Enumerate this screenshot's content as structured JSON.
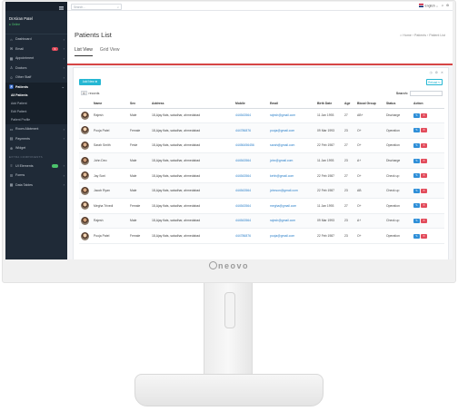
{
  "topbar": {
    "search_placeholder": "Search...",
    "language": "English"
  },
  "sidebar": {
    "user_name": "Dr.Kiran Patel",
    "user_status": "Online",
    "items_top": [
      {
        "label": "Dashboard",
        "icon": "home-icon",
        "name": "dashboard"
      },
      {
        "label": "Email",
        "icon": "envelope-icon",
        "name": "email",
        "badge": "6",
        "badge_color": "#e24b5b"
      },
      {
        "label": "Appointment",
        "icon": "calendar-icon",
        "name": "appointment"
      },
      {
        "label": "Doctors",
        "icon": "user-md-icon",
        "name": "doctors"
      },
      {
        "label": "Other Staff",
        "icon": "users-icon",
        "name": "other-staff"
      }
    ],
    "patients_label": "Patients",
    "patients_sub": [
      "All Patients",
      "Add Patient",
      "Edit Patient",
      "Patient Profile"
    ],
    "items_bottom": [
      {
        "label": "Room Allotment",
        "icon": "bed-icon",
        "name": "room-allotment"
      },
      {
        "label": "Payments",
        "icon": "card-icon",
        "name": "payments"
      }
    ],
    "widget_label": "Widget",
    "section_label": "EXTRA COMPONENTS",
    "items_extra": [
      {
        "label": "UI Elements",
        "icon": "layers-icon",
        "name": "ui-elements",
        "badge": "",
        "badge_color": "#4cc36c"
      },
      {
        "label": "Forms",
        "icon": "form-icon",
        "name": "forms"
      },
      {
        "label": "Data Tables",
        "icon": "table-icon",
        "name": "data-tables"
      }
    ]
  },
  "page": {
    "title": "Patients List",
    "breadcrumb": "⌂ Home  ›  Patients  ›  Patient List",
    "tabs": [
      "List View",
      "Grid View"
    ]
  },
  "card": {
    "tools": "◷ ⚙ ✕",
    "add_label": "Add New ✚",
    "reload_label": "Reload ↻",
    "length_value": "10",
    "length_suffix": "records",
    "search_label": "Search:"
  },
  "table": {
    "headers": [
      "",
      "Name",
      "Sex",
      "Address",
      "Mobile",
      "Email",
      "Birth Date",
      "Age",
      "Blood Group",
      "Status",
      "Action"
    ],
    "rows": [
      {
        "name": "Rajesh",
        "sex": "Male",
        "address": "18,Ajay flats, satadhar, ahmedabad",
        "mobile": "444543564",
        "email": "rajesh@gmail.com",
        "birth": "11 Jan 1993",
        "age": "27",
        "blood": "AB+",
        "status": "Discharge"
      },
      {
        "name": "Pooja Patel",
        "sex": "Female",
        "address": "18,Ajay flats, satadhar, ahmedabad",
        "mobile": "444786876",
        "email": "pooja@gmail.com",
        "birth": "09 Mar 1993",
        "age": "23",
        "blood": "O+",
        "status": "Operation"
      },
      {
        "name": "Sarah Smith",
        "sex": "Fesle",
        "address": "18,Ajay flats, satadhar, ahmedabad",
        "mobile": "44456456456",
        "email": "sarah@gmail.com",
        "birth": "22 Feb 1987",
        "age": "27",
        "blood": "O+",
        "status": "Operation"
      },
      {
        "name": "John Deo",
        "sex": "Male",
        "address": "18,Ajay flats, satadhar, ahmedabad",
        "mobile": "444543564",
        "email": "john@gmail.com",
        "birth": "11 Jan 1993",
        "age": "23",
        "blood": "A+",
        "status": "Discharge"
      },
      {
        "name": "Jay Soni",
        "sex": "Male",
        "address": "18,Ajay flats, satadhar, ahmedabad",
        "mobile": "444543564",
        "email": "kehh@gmail.com",
        "birth": "22 Feb 1987",
        "age": "27",
        "blood": "O+",
        "status": "Check up"
      },
      {
        "name": "Jacob Ryan",
        "sex": "Male",
        "address": "18,Ajay flats, satadhar, ahmedabad",
        "mobile": "444543564",
        "email": "johnson@gmail.com",
        "birth": "22 Feb 1987",
        "age": "23",
        "blood": "AB",
        "status": "Check up"
      },
      {
        "name": "Megha Trivedi",
        "sex": "Female",
        "address": "18,Ajay flats, satadhar, ahmedabad",
        "mobile": "444543564",
        "email": "megha@gmail.com",
        "birth": "11 Jan 1993",
        "age": "27",
        "blood": "O+",
        "status": "Operation"
      },
      {
        "name": "Rajesh",
        "sex": "Male",
        "address": "18,Ajay flats, satadhar, ahmedabad",
        "mobile": "444543564",
        "email": "rajesh@gmail.com",
        "birth": "09 Mar 1993",
        "age": "23",
        "blood": "A+",
        "status": "Check up"
      },
      {
        "name": "Pooja Patel",
        "sex": "Female",
        "address": "18,Ajay flats, satadhar, ahmedabad",
        "mobile": "444786876",
        "email": "pooja@gmail.com",
        "birth": "22 Feb 1987",
        "age": "23",
        "blood": "O+",
        "status": "Operation"
      }
    ]
  },
  "monitor": {
    "brand": "neovo"
  },
  "colors": {
    "accent_red": "#d64545",
    "button_cyan": "#25b7d3",
    "sidebar_bg": "#1f2a37",
    "edit_blue": "#2f8fd8",
    "delete_red": "#e24b5b"
  }
}
